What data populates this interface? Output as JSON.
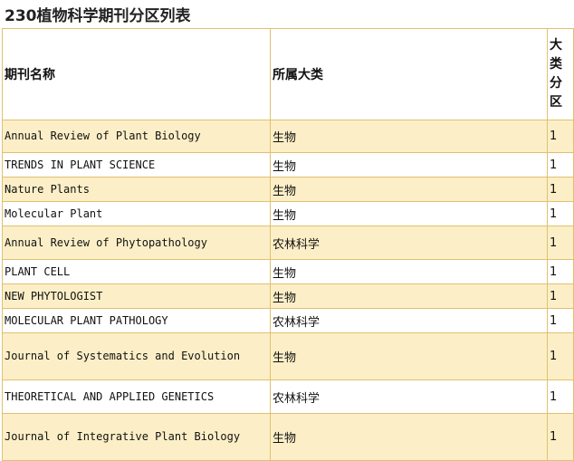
{
  "page_title": "230植物科学期刊分区列表",
  "table": {
    "headers": {
      "name": "期刊名称",
      "category": "所属大类",
      "zone_chars": [
        "大",
        "类",
        "分",
        "区"
      ]
    },
    "rows": [
      {
        "name": "Annual Review of Plant Biology",
        "category": "生物",
        "zone": "1"
      },
      {
        "name": "TRENDS IN PLANT SCIENCE",
        "category": "生物",
        "zone": "1"
      },
      {
        "name": "Nature Plants",
        "category": "生物",
        "zone": "1"
      },
      {
        "name": "Molecular Plant",
        "category": "生物",
        "zone": "1"
      },
      {
        "name": "Annual Review of Phytopathology",
        "category": "农林科学",
        "zone": "1"
      },
      {
        "name": "PLANT CELL",
        "category": "生物",
        "zone": "1"
      },
      {
        "name": "NEW PHYTOLOGIST",
        "category": "生物",
        "zone": "1"
      },
      {
        "name": "MOLECULAR PLANT PATHOLOGY",
        "category": "农林科学",
        "zone": "1"
      },
      {
        "name": "Journal of Systematics and Evolution",
        "category": "生物",
        "zone": "1"
      },
      {
        "name": "THEORETICAL AND APPLIED GENETICS",
        "category": "农林科学",
        "zone": "1"
      },
      {
        "name": "Journal of Integrative Plant Biology",
        "category": "生物",
        "zone": "1"
      }
    ]
  },
  "colors": {
    "border": "#e0c070",
    "stripe": "#fcefc7",
    "text": "#111111"
  }
}
